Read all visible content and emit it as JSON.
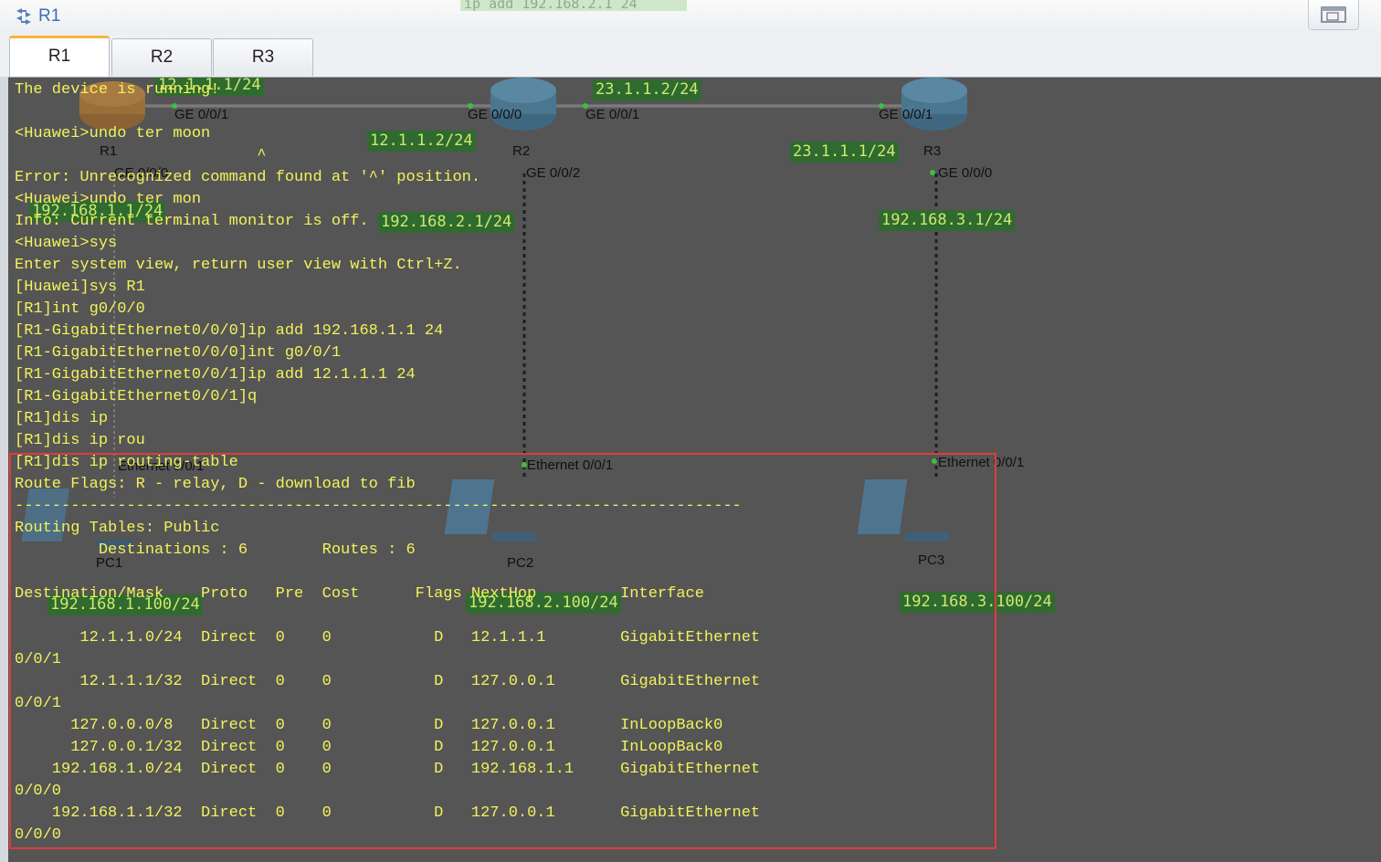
{
  "window": {
    "title": "R1",
    "title_ghost_text": "ip add 192.168.2.1 24"
  },
  "tabs": [
    {
      "label": "R1",
      "active": true
    },
    {
      "label": "R2",
      "active": false
    },
    {
      "label": "R3",
      "active": false
    }
  ],
  "topology": {
    "devices": {
      "r1": "R1",
      "r2": "R2",
      "r3": "R3",
      "pc1": "PC1",
      "pc2": "PC2",
      "pc3": "PC3"
    },
    "ports": {
      "r1_ge001": "GE 0/0/1",
      "r2_ge000": "GE 0/0/0",
      "r2_ge001": "GE 0/0/1",
      "r3_ge001": "GE 0/0/1",
      "r1_ge000": "GE 0/0/0",
      "r2_ge002": "GE 0/0/2",
      "r3_ge000": "GE 0/0/0",
      "pc1_eth": "Ethernet 0/0/1",
      "pc2_eth": "Ethernet 0/0/1",
      "pc3_eth": "Ethernet 0/0/1"
    },
    "ip_labels": {
      "r1_wan": "12.1.1.1/24",
      "r2_wan_left": "12.1.1.2/24",
      "r2_wan_right": "23.1.1.2/24",
      "r3_wan": "23.1.1.1/24",
      "r1_lan": "192.168.1.1/24",
      "r2_lan": "192.168.2.1/24",
      "r3_lan": "192.168.3.1/24",
      "pc1_ip": "192.168.1.100/24",
      "pc2_ip": "192.168.2.100/24",
      "pc3_ip": "192.168.3.100/24"
    }
  },
  "console": {
    "lines": [
      "The device is running!",
      "",
      "<Huawei>undo ter moon",
      "                          ^",
      "Error: Unrecognized command found at '^' position.",
      "<Huawei>undo ter mon",
      "Info: Current terminal monitor is off.",
      "<Huawei>sys",
      "Enter system view, return user view with Ctrl+Z.",
      "[Huawei]sys R1",
      "[R1]int g0/0/0",
      "[R1-GigabitEthernet0/0/0]ip add 192.168.1.1 24",
      "[R1-GigabitEthernet0/0/0]int g0/0/1",
      "[R1-GigabitEthernet0/0/1]ip add 12.1.1.1 24",
      "[R1-GigabitEthernet0/0/1]q",
      "[R1]dis ip",
      "[R1]dis ip rou",
      "[R1]dis ip routing-table",
      "Route Flags: R - relay, D - download to fib",
      "------------------------------------------------------------------------------",
      "Routing Tables: Public",
      "         Destinations : 6        Routes : 6",
      "",
      "Destination/Mask    Proto   Pre  Cost      Flags NextHop         Interface",
      "",
      "       12.1.1.0/24  Direct  0    0           D   12.1.1.1        GigabitEthernet",
      "0/0/1",
      "       12.1.1.1/32  Direct  0    0           D   127.0.0.1       GigabitEthernet",
      "0/0/1",
      "      127.0.0.0/8   Direct  0    0           D   127.0.0.1       InLoopBack0",
      "      127.0.0.1/32  Direct  0    0           D   127.0.0.1       InLoopBack0",
      "    192.168.1.0/24  Direct  0    0           D   192.168.1.1     GigabitEthernet",
      "0/0/0",
      "    192.168.1.1/32  Direct  0    0           D   127.0.0.1       GigabitEthernet",
      "0/0/0"
    ]
  },
  "colors": {
    "terminal_bg": "#555555",
    "terminal_text": "#f2f25c",
    "ip_label_bg": "#2f6b2f",
    "highlight": "#e23b3b",
    "tab_accent": "#f0b83a"
  }
}
